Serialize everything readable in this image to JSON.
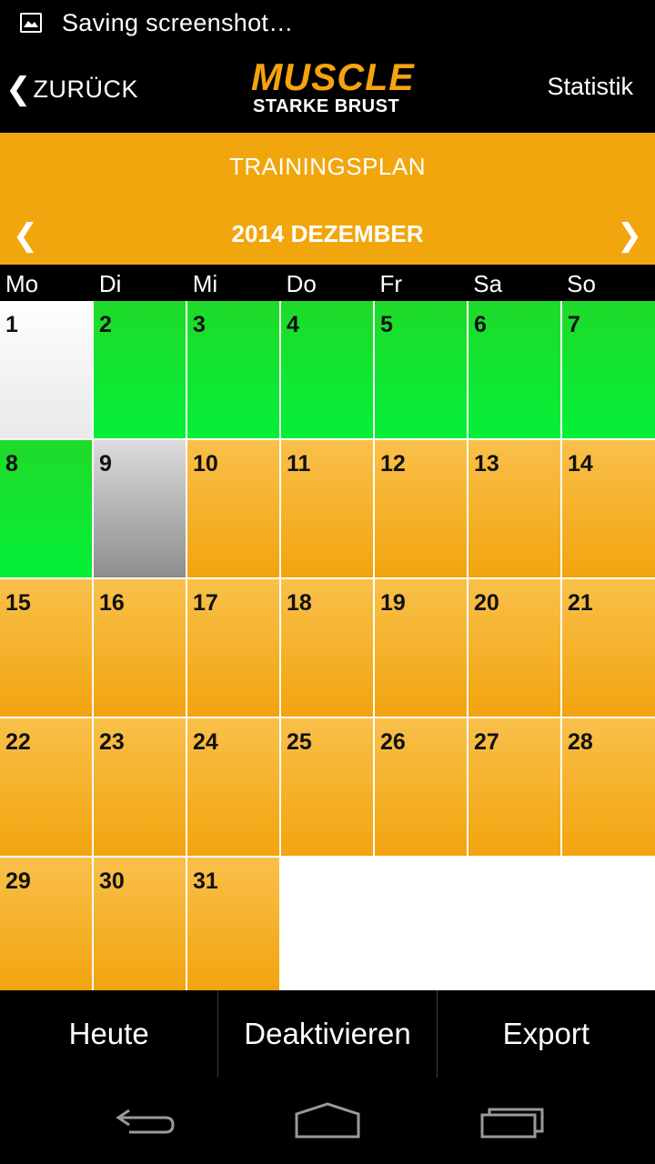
{
  "status_bar": {
    "text": "Saving screenshot…",
    "icon": "image-icon"
  },
  "header": {
    "back_chevron": "❮",
    "back_label": "ZURÜCK",
    "logo_top": "MUSCLE",
    "logo_bottom": "STARKE BRUST",
    "stat_label": "Statistik"
  },
  "plan": {
    "title": "TRAININGSPLAN"
  },
  "month": {
    "prev": "❮",
    "label": "2014 DEZEMBER",
    "next": "❯"
  },
  "weekdays": [
    "Mo",
    "Di",
    "Mi",
    "Do",
    "Fr",
    "Sa",
    "So"
  ],
  "days": [
    {
      "day": "1",
      "status": "white"
    },
    {
      "day": "2",
      "status": "green"
    },
    {
      "day": "3",
      "status": "green"
    },
    {
      "day": "4",
      "status": "green"
    },
    {
      "day": "5",
      "status": "green"
    },
    {
      "day": "6",
      "status": "green"
    },
    {
      "day": "7",
      "status": "green"
    },
    {
      "day": "8",
      "status": "green"
    },
    {
      "day": "9",
      "status": "gray"
    },
    {
      "day": "10",
      "status": "orange"
    },
    {
      "day": "11",
      "status": "orange"
    },
    {
      "day": "12",
      "status": "orange"
    },
    {
      "day": "13",
      "status": "orange"
    },
    {
      "day": "14",
      "status": "orange"
    },
    {
      "day": "15",
      "status": "orange"
    },
    {
      "day": "16",
      "status": "orange"
    },
    {
      "day": "17",
      "status": "orange"
    },
    {
      "day": "18",
      "status": "orange"
    },
    {
      "day": "19",
      "status": "orange"
    },
    {
      "day": "20",
      "status": "orange"
    },
    {
      "day": "21",
      "status": "orange"
    },
    {
      "day": "22",
      "status": "orange"
    },
    {
      "day": "23",
      "status": "orange"
    },
    {
      "day": "24",
      "status": "orange"
    },
    {
      "day": "25",
      "status": "orange"
    },
    {
      "day": "26",
      "status": "orange"
    },
    {
      "day": "27",
      "status": "orange"
    },
    {
      "day": "28",
      "status": "orange"
    },
    {
      "day": "29",
      "status": "orange"
    },
    {
      "day": "30",
      "status": "orange"
    },
    {
      "day": "31",
      "status": "orange"
    }
  ],
  "bottom_bar": {
    "today": "Heute",
    "deactivate": "Deaktivieren",
    "export": "Export"
  },
  "nav_bar": {
    "back": "back-arrow-icon",
    "home": "home-icon",
    "recents": "recent-apps-icon"
  },
  "colors": {
    "accent": "#F2A60D",
    "green": "#04F037",
    "orange_top": "#F9C04A",
    "orange_bottom": "#F2A40E",
    "gray_top": "#DCDCDC",
    "gray_bottom": "#8D8D8D"
  }
}
